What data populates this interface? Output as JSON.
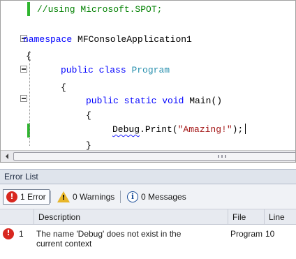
{
  "editor": {
    "code_lines": [
      {
        "parts": [
          {
            "c": "cmt",
            "t": "//using Microsoft.SPOT;"
          }
        ]
      },
      {
        "parts": [
          {
            "c": "kw",
            "t": "namespace"
          },
          {
            "c": "txt",
            "t": " MFConsoleApplication1"
          }
        ]
      },
      {
        "parts": [
          {
            "c": "txt",
            "t": "{"
          }
        ]
      },
      {
        "parts": [
          {
            "c": "kw",
            "t": "public class"
          },
          {
            "c": "txt",
            "t": " "
          },
          {
            "c": "typ",
            "t": "Program"
          }
        ]
      },
      {
        "parts": [
          {
            "c": "txt",
            "t": "{"
          }
        ]
      },
      {
        "parts": [
          {
            "c": "kw",
            "t": "public static void"
          },
          {
            "c": "txt",
            "t": " Main()"
          }
        ]
      },
      {
        "parts": [
          {
            "c": "txt",
            "t": "{"
          }
        ]
      },
      {
        "parts": [
          {
            "c": "txt squiggle",
            "t": "Debug"
          },
          {
            "c": "txt",
            "t": ".Print("
          },
          {
            "c": "str",
            "t": "\"Amazing!\""
          },
          {
            "c": "txt",
            "t": ");"
          }
        ],
        "caret": true
      },
      {
        "parts": [
          {
            "c": "txt",
            "t": "}"
          }
        ]
      }
    ]
  },
  "scrollbar": {
    "left_arrow_icon": "arrow-left-icon"
  },
  "error_list": {
    "title": "Error List",
    "filters": {
      "errors": "1 Error",
      "warnings": "0 Warnings",
      "messages": "0 Messages"
    },
    "icons": {
      "error": "!",
      "warning": "!",
      "info": "i"
    },
    "columns": {
      "description": "Description",
      "file": "File",
      "line": "Line"
    },
    "rows": [
      {
        "number": "1",
        "description_line1": "The name 'Debug' does not exist in the",
        "description_line2": "current context",
        "file": "Program",
        "line": "10"
      }
    ]
  },
  "colors": {
    "keyword": "#0000ff",
    "type": "#2b91af",
    "comment": "#008000",
    "string": "#a31515",
    "error_icon": "#d8271f",
    "warning_icon": "#e8b62a",
    "change_bar": "#2fb52f"
  }
}
